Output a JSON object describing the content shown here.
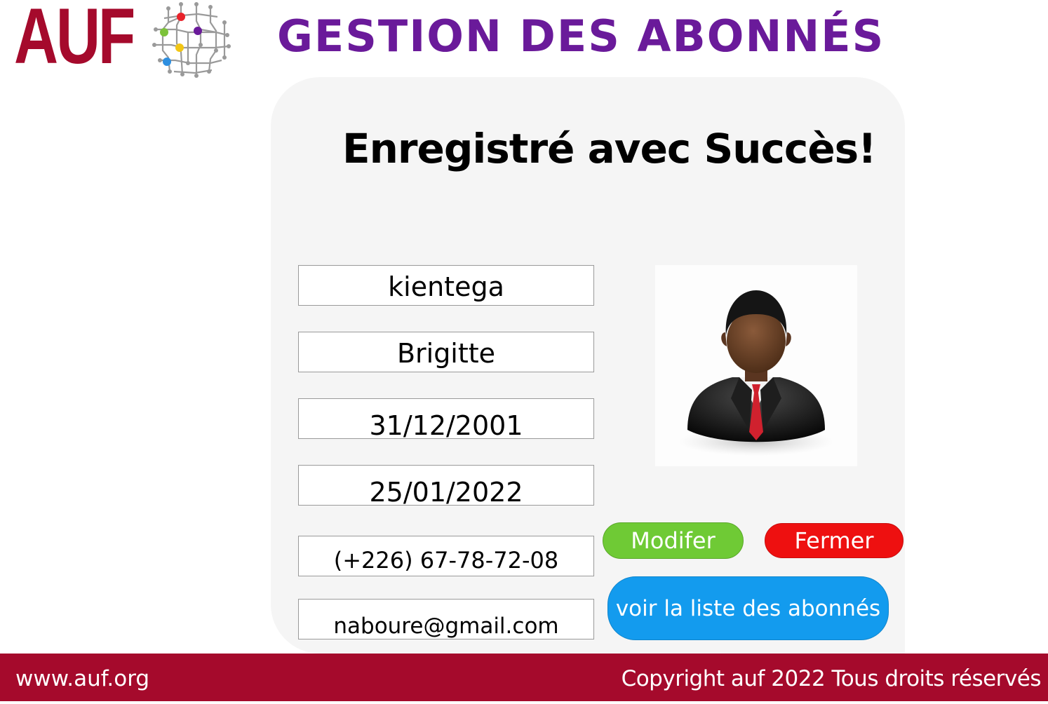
{
  "header": {
    "logo_text": "AUF",
    "title": "GESTION DES ABONNÉS"
  },
  "card": {
    "heading": "Enregistré avec Succès!",
    "fields": {
      "nom": "kientega",
      "prenom": "Brigitte",
      "date_naissance": "31/12/2001",
      "date_inscription": "25/01/2022",
      "telephone": "(+226) 67-78-72-08",
      "email": "naboure@gmail.com"
    },
    "photo_icon": "avatar-businessman-icon"
  },
  "buttons": {
    "modify": "Modifer",
    "close": "Fermer",
    "list": "voir la liste des abonnés"
  },
  "footer": {
    "website": "www.auf.org",
    "copyright": "Copyright auf 2022 Tous droits réservés"
  },
  "colors": {
    "brand": "#a50a2c",
    "title": "#6a1a9a",
    "modify": "#6fca35",
    "close": "#ee1010",
    "list": "#139bee"
  }
}
